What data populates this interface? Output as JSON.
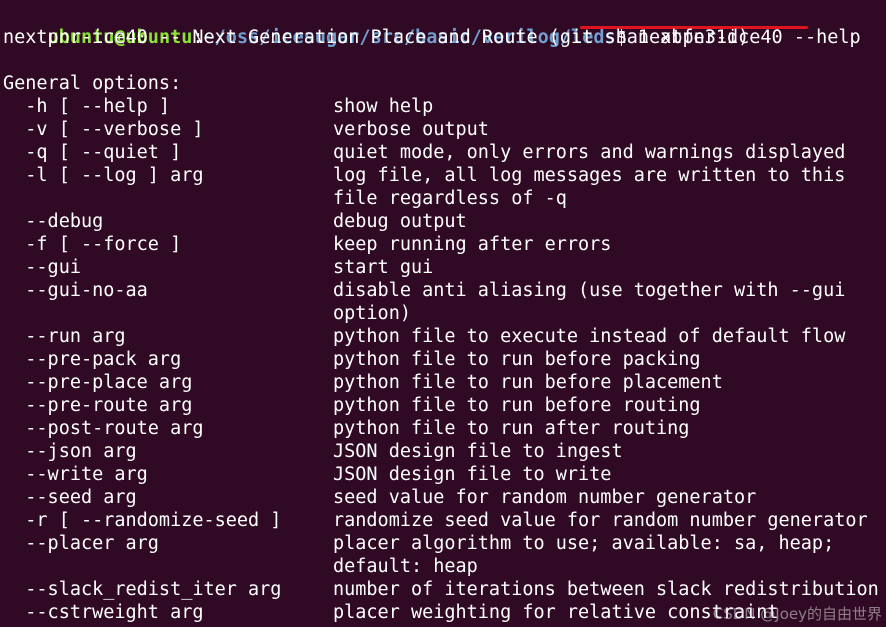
{
  "prompt": {
    "user_host": "ubuntu@ubuntu",
    "separator": ":",
    "path": "~/oss/icesugar/src/basic/verilog/leds",
    "symbol": "$ ",
    "command": "nextpnr-ice40 --help"
  },
  "colors": {
    "background": "#300a24",
    "text": "#ffffff",
    "user_host": "#8ae234",
    "path": "#729fcf",
    "underline": "#e0141e"
  },
  "banner": "nextpnr-ice40 -- Next Generation Place and Route (git sha1 abfe31d)",
  "section_header": "General options:",
  "options": [
    {
      "opt": "  -h [ --help ]",
      "desc": "show help"
    },
    {
      "opt": "  -v [ --verbose ]",
      "desc": "verbose output"
    },
    {
      "opt": "  -q [ --quiet ]",
      "desc": "quiet mode, only errors and warnings displayed"
    },
    {
      "opt": "  -l [ --log ] arg",
      "desc": "log file, all log messages are written to this"
    },
    {
      "opt": "",
      "desc": "file regardless of -q"
    },
    {
      "opt": "  --debug",
      "desc": "debug output"
    },
    {
      "opt": "  -f [ --force ]",
      "desc": "keep running after errors"
    },
    {
      "opt": "  --gui",
      "desc": "start gui"
    },
    {
      "opt": "  --gui-no-aa",
      "desc": "disable anti aliasing (use together with --gui"
    },
    {
      "opt": "",
      "desc": "option)"
    },
    {
      "opt": "  --run arg",
      "desc": "python file to execute instead of default flow"
    },
    {
      "opt": "  --pre-pack arg",
      "desc": "python file to run before packing"
    },
    {
      "opt": "  --pre-place arg",
      "desc": "python file to run before placement"
    },
    {
      "opt": "  --pre-route arg",
      "desc": "python file to run before routing"
    },
    {
      "opt": "  --post-route arg",
      "desc": "python file to run after routing"
    },
    {
      "opt": "  --json arg",
      "desc": "JSON design file to ingest"
    },
    {
      "opt": "  --write arg",
      "desc": "JSON design file to write"
    },
    {
      "opt": "  --seed arg",
      "desc": "seed value for random number generator"
    },
    {
      "opt": "  -r [ --randomize-seed ]",
      "desc": "randomize seed value for random number generator"
    },
    {
      "opt": "  --placer arg",
      "desc": "placer algorithm to use; available: sa, heap;"
    },
    {
      "opt": "",
      "desc": "default: heap"
    },
    {
      "opt": "  --slack_redist_iter arg",
      "desc": "number of iterations between slack redistribution"
    },
    {
      "opt": "  --cstrweight arg",
      "desc": "placer weighting for relative constraint"
    }
  ],
  "watermark": "CSDN @Joey的自由世界"
}
